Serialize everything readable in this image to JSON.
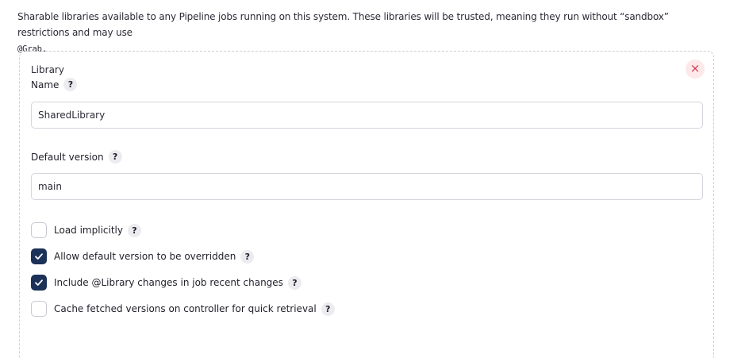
{
  "intro": {
    "text": "Sharable libraries available to any Pipeline jobs running on this system. These libraries will be trusted, meaning they run without “sandbox” restrictions and may use ",
    "code": "@Grab."
  },
  "library": {
    "heading": "Library",
    "close_symbol": "×",
    "name_label": "Name",
    "name_value": "SharedLibrary",
    "default_version_label": "Default version",
    "default_version_value": "main",
    "help_symbol": "?"
  },
  "options": [
    {
      "label": "Load implicitly",
      "checked": false
    },
    {
      "label": "Allow default version to be overridden",
      "checked": true
    },
    {
      "label": "Include @Library changes in job recent changes",
      "checked": true
    },
    {
      "label": "Cache fetched versions on controller for quick retrieval",
      "checked": false
    }
  ],
  "colors": {
    "accent": "#1c3158",
    "close_bg": "#fde8ea",
    "close_fg": "#d23a4e",
    "help_bg": "#ececf0"
  }
}
